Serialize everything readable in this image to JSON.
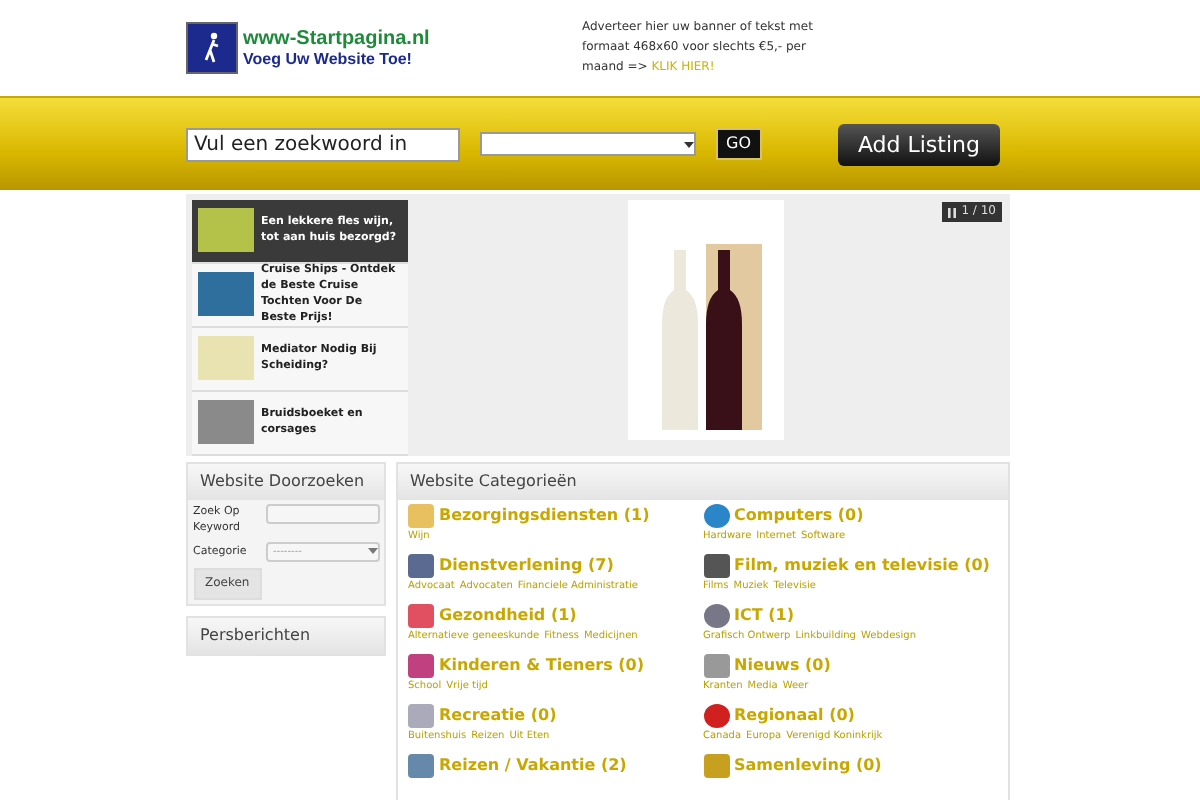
{
  "header": {
    "logo": {
      "title": "www-Startpagina.nl",
      "tagline": "Voeg Uw Website Toe!"
    },
    "ad": {
      "text": "Adverteer hier uw banner of tekst met formaat 468x60 voor slechts €5,- per maand =>",
      "link": "KLIK HIER!"
    }
  },
  "search_bar": {
    "placeholder": "Vul een zoekwoord in",
    "go": "GO",
    "add_listing": "Add Listing"
  },
  "slider": {
    "items": [
      {
        "title": "Een lekkere fles wijn, tot aan huis bezorgd?",
        "selected": true
      },
      {
        "title": "Cruise Ships - Ontdek de Beste Cruise Tochten Voor De Beste Prijs!",
        "selected": false
      },
      {
        "title": "Mediator Nodig Bij Scheiding?",
        "selected": false
      },
      {
        "title": "Bruidsboeket en corsages",
        "selected": false
      }
    ],
    "counter": "1 / 10"
  },
  "sidebar": {
    "search_panel": {
      "title": "Website Doorzoeken",
      "keyword_label": "Zoek Op Keyword",
      "category_label": "Categorie",
      "category_value": "--------",
      "button": "Zoeken"
    },
    "press": {
      "title": "Persberichten"
    }
  },
  "categories": {
    "title": "Website Categorieën",
    "items": [
      {
        "name": "Bezorgingsdiensten (1)",
        "subs": [
          "Wijn"
        ]
      },
      {
        "name": "Computers (0)",
        "subs": [
          "Hardware",
          "Internet",
          "Software"
        ]
      },
      {
        "name": "Dienstverlening (7)",
        "subs": [
          "Advocaat",
          "Advocaten",
          "Financiele Administratie"
        ]
      },
      {
        "name": "Film, muziek en televisie (0)",
        "subs": [
          "Films",
          "Muziek",
          "Televisie"
        ]
      },
      {
        "name": "Gezondheid (1)",
        "subs": [
          "Alternatieve geneeskunde",
          "Fitness",
          "Medicijnen"
        ]
      },
      {
        "name": "ICT (1)",
        "subs": [
          "Grafisch Ontwerp",
          "Linkbuilding",
          "Webdesign"
        ]
      },
      {
        "name": "Kinderen & Tieners (0)",
        "subs": [
          "School",
          "Vrije tijd"
        ]
      },
      {
        "name": "Nieuws (0)",
        "subs": [
          "Kranten",
          "Media",
          "Weer"
        ]
      },
      {
        "name": "Recreatie (0)",
        "subs": [
          "Buitenshuis",
          "Reizen",
          "Uit Eten"
        ]
      },
      {
        "name": "Regionaal (0)",
        "subs": [
          "Canada",
          "Europa",
          "Verenigd Koninkrijk"
        ]
      },
      {
        "name": "Reizen / Vakantie (2)"
      },
      {
        "name": "Samenleving (0)"
      }
    ]
  }
}
